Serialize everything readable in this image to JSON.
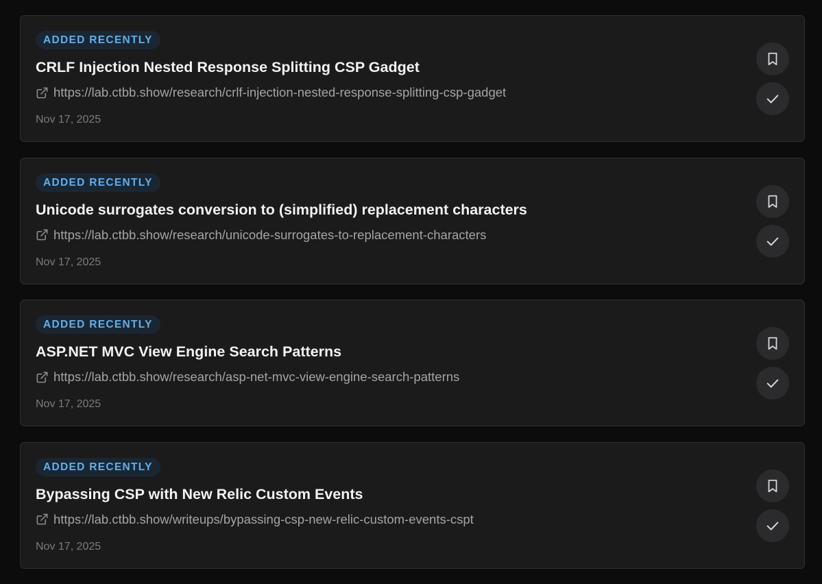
{
  "items": [
    {
      "badge": "ADDED RECENTLY",
      "title": "CRLF Injection Nested Response Splitting CSP Gadget",
      "url": "https://lab.ctbb.show/research/crlf-injection-nested-response-splitting-csp-gadget",
      "date": "Nov 17, 2025"
    },
    {
      "badge": "ADDED RECENTLY",
      "title": "Unicode surrogates conversion to (simplified) replacement characters",
      "url": "https://lab.ctbb.show/research/unicode-surrogates-to-replacement-characters",
      "date": "Nov 17, 2025"
    },
    {
      "badge": "ADDED RECENTLY",
      "title": "ASP.NET MVC View Engine Search Patterns",
      "url": "https://lab.ctbb.show/research/asp-net-mvc-view-engine-search-patterns",
      "date": "Nov 17, 2025"
    },
    {
      "badge": "ADDED RECENTLY",
      "title": "Bypassing CSP with New Relic Custom Events",
      "url": "https://lab.ctbb.show/writeups/bypassing-csp-new-relic-custom-events-cspt",
      "date": "Nov 17, 2025"
    }
  ],
  "icons": {
    "link": "external-link-icon",
    "bookmark": "bookmark-icon",
    "done": "checkmark-icon"
  },
  "colors": {
    "badge_text": "#5fb0ec",
    "badge_bg": "#1b2633",
    "card_bg": "#1b1b1c"
  }
}
